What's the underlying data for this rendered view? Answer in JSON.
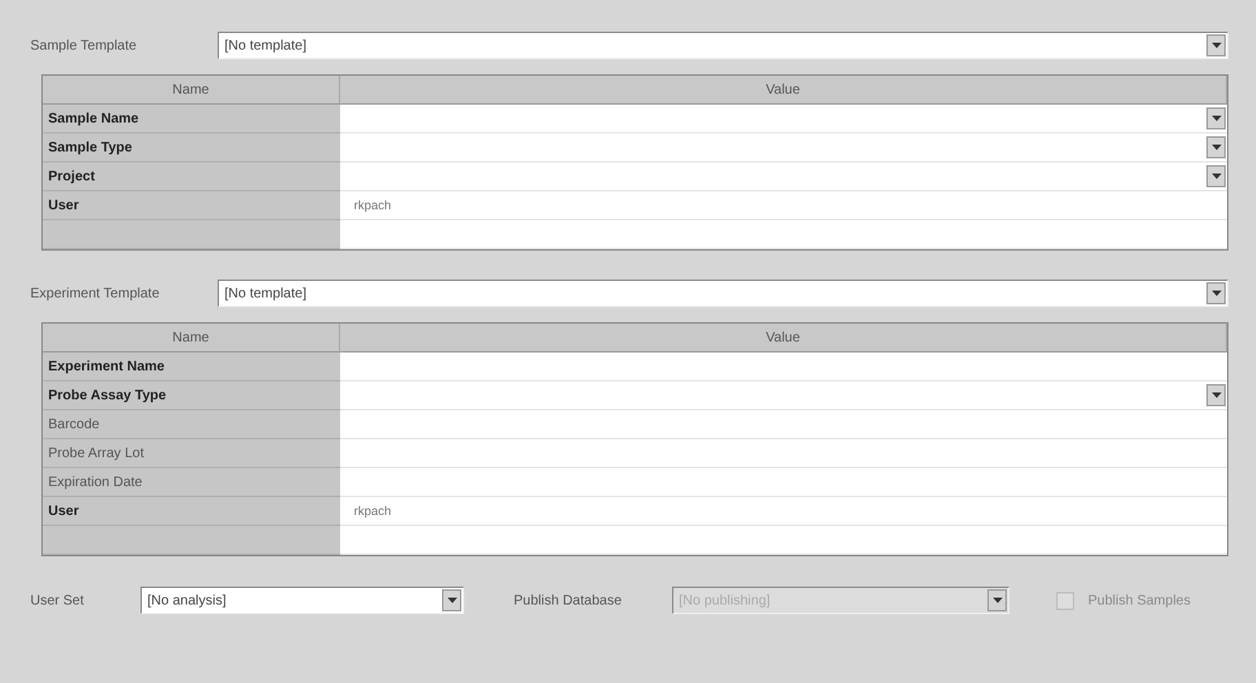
{
  "sections": [
    {
      "template_label": "Sample Template",
      "template_value": "[No template]",
      "columns": [
        "Name",
        "Value"
      ],
      "rows": [
        {
          "name": "Sample Name",
          "required": true,
          "kind": "dropdown"
        },
        {
          "name": "Sample Type",
          "required": true,
          "kind": "dropdown"
        },
        {
          "name": "Project",
          "required": true,
          "kind": "dropdown"
        },
        {
          "name": "User",
          "required": true,
          "kind": "text",
          "value": "rkpach"
        },
        {
          "kind": "blank"
        }
      ]
    },
    {
      "template_label": "Experiment Template",
      "template_value": "[No template]",
      "columns": [
        "Name",
        "Value"
      ],
      "rows": [
        {
          "name": "Experiment Name",
          "required": true,
          "kind": "text"
        },
        {
          "name": "Probe Assay Type",
          "required": true,
          "kind": "dropdown"
        },
        {
          "name": "Barcode",
          "required": false,
          "kind": "text"
        },
        {
          "name": "Probe Array Lot",
          "required": false,
          "kind": "text"
        },
        {
          "name": "Expiration Date",
          "required": false,
          "kind": "text"
        },
        {
          "name": "User",
          "required": true,
          "kind": "text",
          "value": "rkpach"
        },
        {
          "kind": "blank"
        }
      ]
    }
  ],
  "footer": {
    "user_set": {
      "label": "User Set",
      "value": "[No analysis]",
      "disabled": false
    },
    "publish": {
      "label": "Publish Database",
      "value": "[No publishing]",
      "disabled": true
    },
    "checkbox": {
      "label": "Publish Samples",
      "checked": false,
      "disabled": true
    }
  }
}
